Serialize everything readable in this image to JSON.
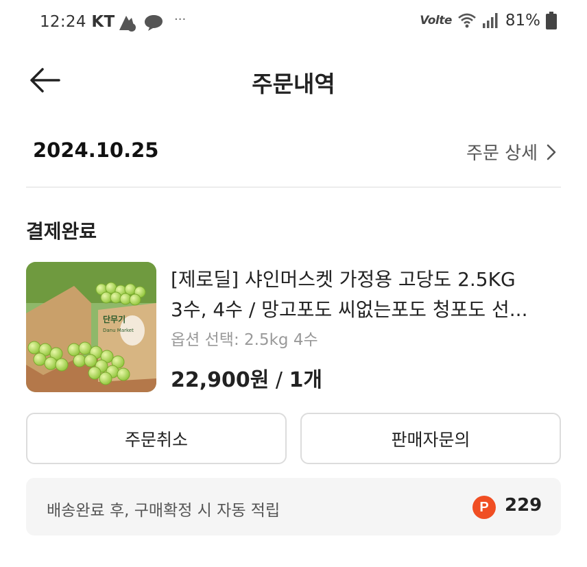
{
  "status_bar": {
    "time": "12:24",
    "carrier": "KT",
    "volte": "Volte",
    "battery_percent": "81%",
    "more": "···"
  },
  "header": {
    "title": "주문내역",
    "back_icon": "arrow-left-icon"
  },
  "order": {
    "date": "2024.10.25",
    "detail_link": "주문 상세",
    "status": "결제완료"
  },
  "product": {
    "title_line1": "[제로딜] 샤인머스켓 가정용 고당도 2.5KG",
    "title_line2": "3수, 4수 / 망고포도 씨없는포도 청포도 선...",
    "option": "옵션 선택: 2.5kg 4수",
    "price": "22,900원",
    "separator": " / ",
    "quantity": "1개",
    "thumbnail_box_label": "단무기",
    "thumbnail_box_sublabel": "Danu Market"
  },
  "buttons": {
    "cancel": "주문취소",
    "inquiry": "판매자문의"
  },
  "points": {
    "description": "배송완료 후, 구매확정 시 자동 적립",
    "badge": "P",
    "value": "229"
  },
  "colors": {
    "accent": "#f04e23",
    "text": "#222222",
    "muted": "#999999",
    "border": "#dcdcdc",
    "panel": "#f5f5f5"
  }
}
